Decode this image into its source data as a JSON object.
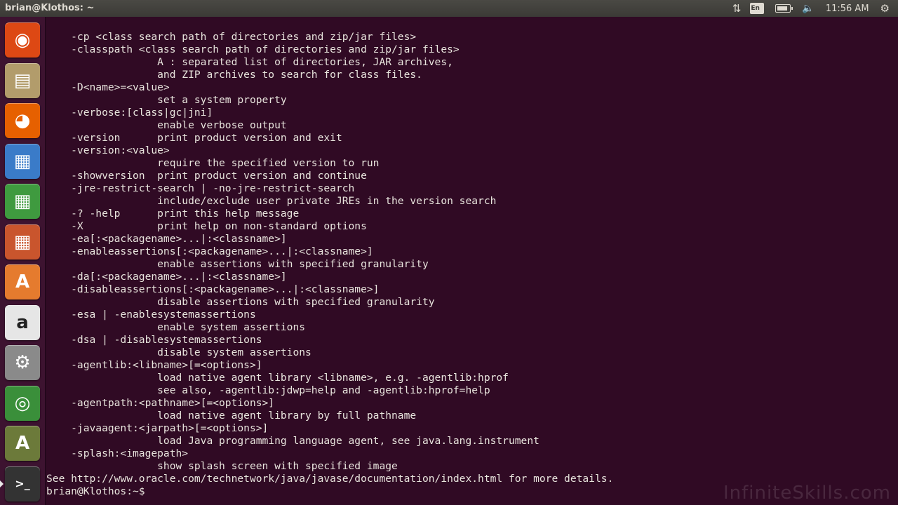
{
  "panel": {
    "window_title": "brian@Klothos: ~",
    "keyboard_layout": "En",
    "clock": "11:56 AM"
  },
  "launcher": {
    "items": [
      {
        "name": "dash-home",
        "glyph": "◉",
        "color": "#dd4814"
      },
      {
        "name": "files",
        "glyph": "▤",
        "color": "#b29c6b"
      },
      {
        "name": "firefox",
        "glyph": "◕",
        "color": "#e66000"
      },
      {
        "name": "libreoffice-writer",
        "glyph": "▦",
        "color": "#3a7bc8"
      },
      {
        "name": "libreoffice-calc",
        "glyph": "▦",
        "color": "#3f9a3f"
      },
      {
        "name": "libreoffice-impress",
        "glyph": "▦",
        "color": "#c9552d"
      },
      {
        "name": "software-center",
        "glyph": "A",
        "color": "#e57b2e"
      },
      {
        "name": "amazon",
        "glyph": "a",
        "color": "#e6e6e6"
      },
      {
        "name": "system-settings",
        "glyph": "⚙",
        "color": "#8a8a8a"
      },
      {
        "name": "chrome",
        "glyph": "◎",
        "color": "#3a8f3a"
      },
      {
        "name": "software-updater",
        "glyph": "A",
        "color": "#6c7a3a"
      },
      {
        "name": "terminal",
        "glyph": ">_",
        "color": "#333333"
      }
    ]
  },
  "terminal": {
    "lines": [
      "    -cp <class search path of directories and zip/jar files>",
      "    -classpath <class search path of directories and zip/jar files>",
      "                  A : separated list of directories, JAR archives,",
      "                  and ZIP archives to search for class files.",
      "    -D<name>=<value>",
      "                  set a system property",
      "    -verbose:[class|gc|jni]",
      "                  enable verbose output",
      "    -version      print product version and exit",
      "    -version:<value>",
      "                  require the specified version to run",
      "    -showversion  print product version and continue",
      "    -jre-restrict-search | -no-jre-restrict-search",
      "                  include/exclude user private JREs in the version search",
      "    -? -help      print this help message",
      "    -X            print help on non-standard options",
      "    -ea[:<packagename>...|:<classname>]",
      "    -enableassertions[:<packagename>...|:<classname>]",
      "                  enable assertions with specified granularity",
      "    -da[:<packagename>...|:<classname>]",
      "    -disableassertions[:<packagename>...|:<classname>]",
      "                  disable assertions with specified granularity",
      "    -esa | -enablesystemassertions",
      "                  enable system assertions",
      "    -dsa | -disablesystemassertions",
      "                  disable system assertions",
      "    -agentlib:<libname>[=<options>]",
      "                  load native agent library <libname>, e.g. -agentlib:hprof",
      "                  see also, -agentlib:jdwp=help and -agentlib:hprof=help",
      "    -agentpath:<pathname>[=<options>]",
      "                  load native agent library by full pathname",
      "    -javaagent:<jarpath>[=<options>]",
      "                  load Java programming language agent, see java.lang.instrument",
      "    -splash:<imagepath>",
      "                  show splash screen with specified image",
      "See http://www.oracle.com/technetwork/java/javase/documentation/index.html for more details.",
      "brian@Klothos:~$ "
    ]
  },
  "watermark": "InfiniteSkills.com"
}
